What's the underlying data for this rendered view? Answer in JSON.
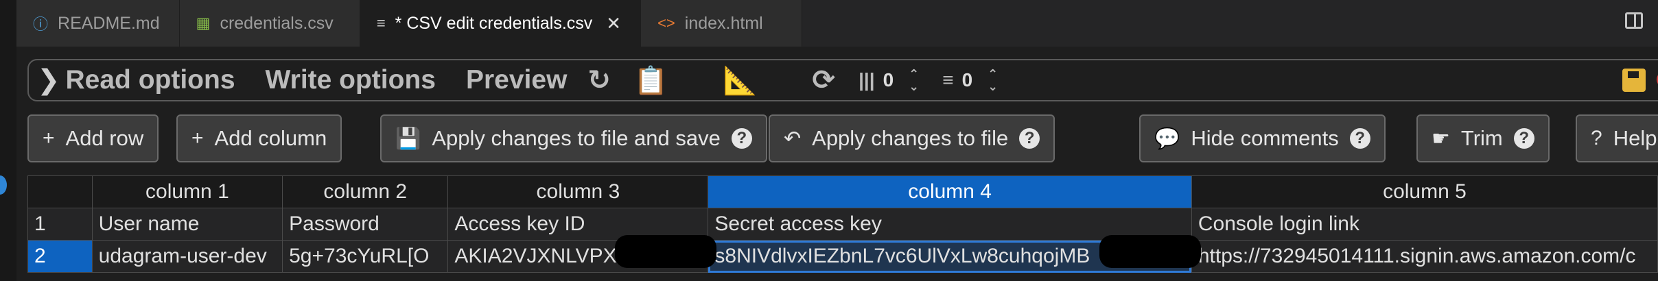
{
  "tabs": [
    {
      "icon": "ⓘ",
      "label": "README.md",
      "icon_color": "#4f9ed6"
    },
    {
      "icon": "▦",
      "label": "credentials.csv",
      "icon_color": "#8bc34a"
    },
    {
      "icon": "≡",
      "label": "* CSV edit credentials.csv",
      "icon_color": "#cccccc",
      "active": true
    },
    {
      "icon": "<>",
      "label": "index.html",
      "icon_color": "#e37933"
    }
  ],
  "options": {
    "read": "Read options",
    "write": "Write options",
    "preview": "Preview",
    "col_count": "0",
    "row_count": "0"
  },
  "buttons": {
    "add_row": "Add row",
    "add_column": "Add column",
    "apply_save": "Apply changes to file and save",
    "apply": "Apply changes to file",
    "hide_comments": "Hide comments",
    "trim": "Trim",
    "help": "Help"
  },
  "table": {
    "headers": [
      "column 1",
      "column 2",
      "column 3",
      "column 4",
      "column 5"
    ],
    "rows": [
      {
        "num": "1",
        "cells": [
          "User name",
          "Password",
          "Access key ID",
          "Secret access key",
          "Console login link"
        ]
      },
      {
        "num": "2",
        "cells": [
          "udagram-user-dev",
          "5g+73cYuRL[O",
          "AKIA2VJXNLVPX",
          "s8NIVdlvxIEZbnL7vc6UlVxLw8cuhqojMB",
          "https://732945014111.signin.aws.amazon.com/c"
        ]
      }
    ]
  },
  "colors": {
    "accent": "#0e63c0",
    "save": "#e5b53a",
    "eye": "#d43a3a"
  }
}
